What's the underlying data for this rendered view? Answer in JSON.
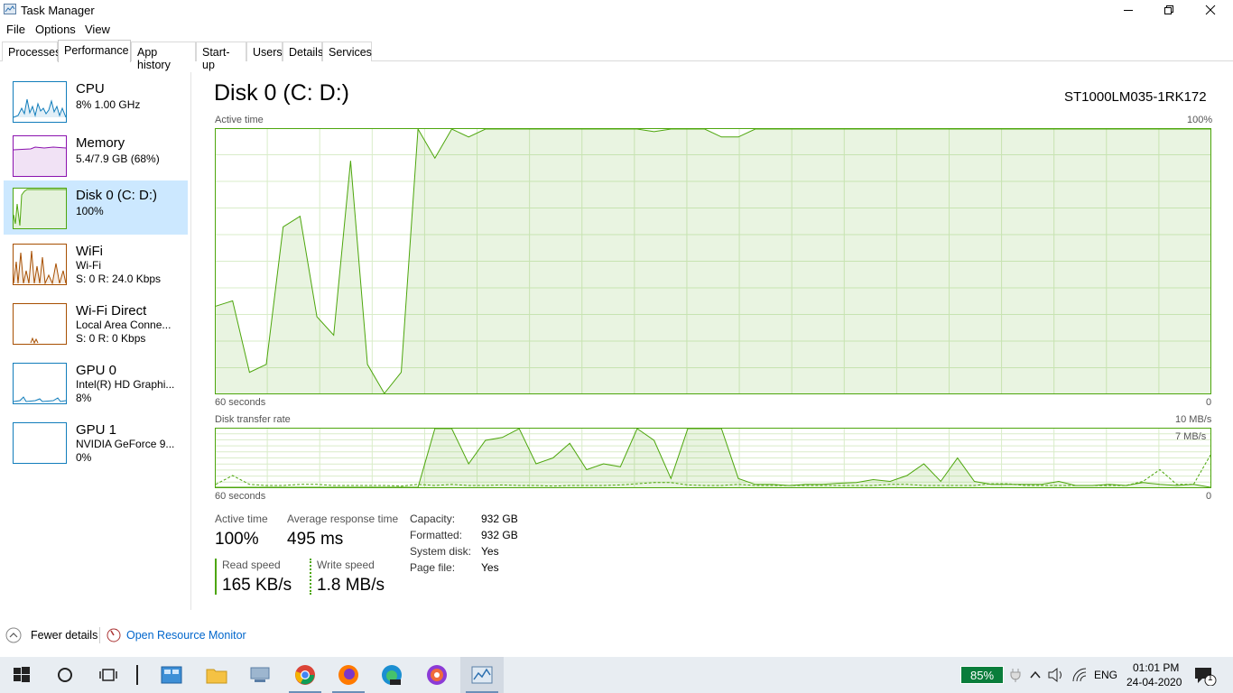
{
  "window": {
    "title": "Task Manager"
  },
  "menu": [
    "File",
    "Options",
    "View"
  ],
  "tabs": [
    "Processes",
    "Performance",
    "App history",
    "Start-up",
    "Users",
    "Details",
    "Services"
  ],
  "sidebar": {
    "items": [
      {
        "title": "CPU",
        "line1": "8% 1.00 GHz",
        "line2": "",
        "color": "#117dbb"
      },
      {
        "title": "Memory",
        "line1": "5.4/7.9 GB (68%)",
        "line2": "",
        "color": "#8b12ae"
      },
      {
        "title": "Disk 0 (C: D:)",
        "line1": "100%",
        "line2": "",
        "color": "#4da60c"
      },
      {
        "title": "WiFi",
        "line1": "Wi-Fi",
        "line2": "S: 0 R: 24.0 Kbps",
        "color": "#a74f01"
      },
      {
        "title": "Wi-Fi Direct",
        "line1": "Local Area Conne...",
        "line2": "S: 0 R: 0 Kbps",
        "color": "#a74f01"
      },
      {
        "title": "GPU 0",
        "line1": "Intel(R) HD Graphi...",
        "line2": "8%",
        "color": "#117dbb"
      },
      {
        "title": "GPU 1",
        "line1": "NVIDIA GeForce 9...",
        "line2": "0%",
        "color": "#117dbb"
      }
    ]
  },
  "main": {
    "title": "Disk 0 (C: D:)",
    "model": "ST1000LM035-1RK172"
  },
  "chart_data": [
    {
      "type": "area",
      "title": "Active time",
      "ymax_label": "100%",
      "xlabel_left": "60 seconds",
      "xlabel_right": "0",
      "ylim": [
        0,
        100
      ],
      "x": [
        0,
        1,
        2,
        3,
        4,
        5,
        6,
        7,
        8,
        9,
        10,
        11,
        12,
        13,
        14,
        15,
        16,
        17,
        18,
        19,
        20,
        21,
        22,
        23,
        24,
        25,
        26,
        27,
        28,
        29,
        30,
        31,
        32,
        33,
        34,
        35,
        36,
        37,
        38,
        39,
        40,
        41,
        42,
        43,
        44,
        45,
        46,
        47,
        48,
        49,
        50,
        51,
        52,
        53,
        54,
        55,
        56,
        57,
        58,
        59
      ],
      "series": [
        {
          "values": [
            33,
            35,
            8,
            11,
            63,
            67,
            29,
            22,
            88,
            11,
            0,
            8,
            100,
            89,
            100,
            97,
            100,
            100,
            100,
            100,
            100,
            100,
            100,
            100,
            100,
            100,
            99,
            100,
            100,
            100,
            97,
            97,
            100,
            100,
            100,
            100,
            100,
            100,
            100,
            100,
            100,
            100,
            100,
            100,
            100,
            100,
            100,
            100,
            100,
            100,
            100,
            100,
            100,
            100,
            100,
            100,
            100,
            100,
            100,
            100
          ]
        }
      ],
      "color": "#4da60c"
    },
    {
      "type": "line",
      "title": "Disk transfer rate",
      "ymax_label": "10 MB/s",
      "secondary_label": "7 MB/s",
      "xlabel_left": "60 seconds",
      "xlabel_right": "0",
      "ylim": [
        0,
        10
      ],
      "x": [
        0,
        1,
        2,
        3,
        4,
        5,
        6,
        7,
        8,
        9,
        10,
        11,
        12,
        13,
        14,
        15,
        16,
        17,
        18,
        19,
        20,
        21,
        22,
        23,
        24,
        25,
        26,
        27,
        28,
        29,
        30,
        31,
        32,
        33,
        34,
        35,
        36,
        37,
        38,
        39,
        40,
        41,
        42,
        43,
        44,
        45,
        46,
        47,
        48,
        49,
        50,
        51,
        52,
        53,
        54,
        55,
        56,
        57,
        58,
        59
      ],
      "series": [
        {
          "name": "Read speed",
          "values": [
            0,
            0,
            0,
            0,
            0,
            0,
            0,
            0,
            0,
            0,
            0,
            0,
            0,
            10,
            10,
            4,
            8,
            8.5,
            10,
            4,
            5,
            7.5,
            3,
            4,
            3.5,
            10,
            8,
            1.5,
            10,
            10,
            10,
            1.5,
            0.5,
            0.5,
            0.3,
            0.5,
            0.5,
            0.7,
            0.8,
            1.3,
            1,
            2,
            4,
            1,
            5,
            1,
            0.5,
            0.5,
            0.5,
            0.5,
            1,
            0.3,
            0.3,
            0.5,
            0.3,
            0.8,
            0.5,
            0.3,
            0.5,
            0
          ]
        },
        {
          "name": "Write speed",
          "values": [
            0.5,
            2,
            0.5,
            0.3,
            0.3,
            0.5,
            0.5,
            0.3,
            0.3,
            0.3,
            0.3,
            0.2,
            0.5,
            0.3,
            0.5,
            0.3,
            0.3,
            0.4,
            0.3,
            0.3,
            0.2,
            0.3,
            0.3,
            0.3,
            0.4,
            0.6,
            0.8,
            0.8,
            0.4,
            0.3,
            0.3,
            0.5,
            0.3,
            0.3,
            0.3,
            0.3,
            0.3,
            0.3,
            0.3,
            0.3,
            0.5,
            0.5,
            0.3,
            0.3,
            0.3,
            0.3,
            0.6,
            0.6,
            0.3,
            0.3,
            0.3,
            0.3,
            0.3,
            0.3,
            0.3,
            1,
            3,
            0.5,
            0.5,
            5.5
          ]
        }
      ],
      "color": "#4da60c"
    }
  ],
  "stats": {
    "active_time_label": "Active time",
    "active_time_value": "100%",
    "avg_response_label": "Average response time",
    "avg_response_value": "495 ms",
    "read_label": "Read speed",
    "read_value": "165 KB/s",
    "write_label": "Write speed",
    "write_value": "1.8 MB/s"
  },
  "properties": [
    {
      "label": "Capacity:",
      "value": "932 GB"
    },
    {
      "label": "Formatted:",
      "value": "932 GB"
    },
    {
      "label": "System disk:",
      "value": "Yes"
    },
    {
      "label": "Page file:",
      "value": "Yes"
    }
  ],
  "footer": {
    "fewer_details": "Fewer details",
    "resource_monitor": "Open Resource Monitor"
  },
  "taskbar": {
    "battery": "85%",
    "language": "ENG",
    "time": "01:01 PM",
    "date": "24-04-2020",
    "notification_count": "1"
  }
}
